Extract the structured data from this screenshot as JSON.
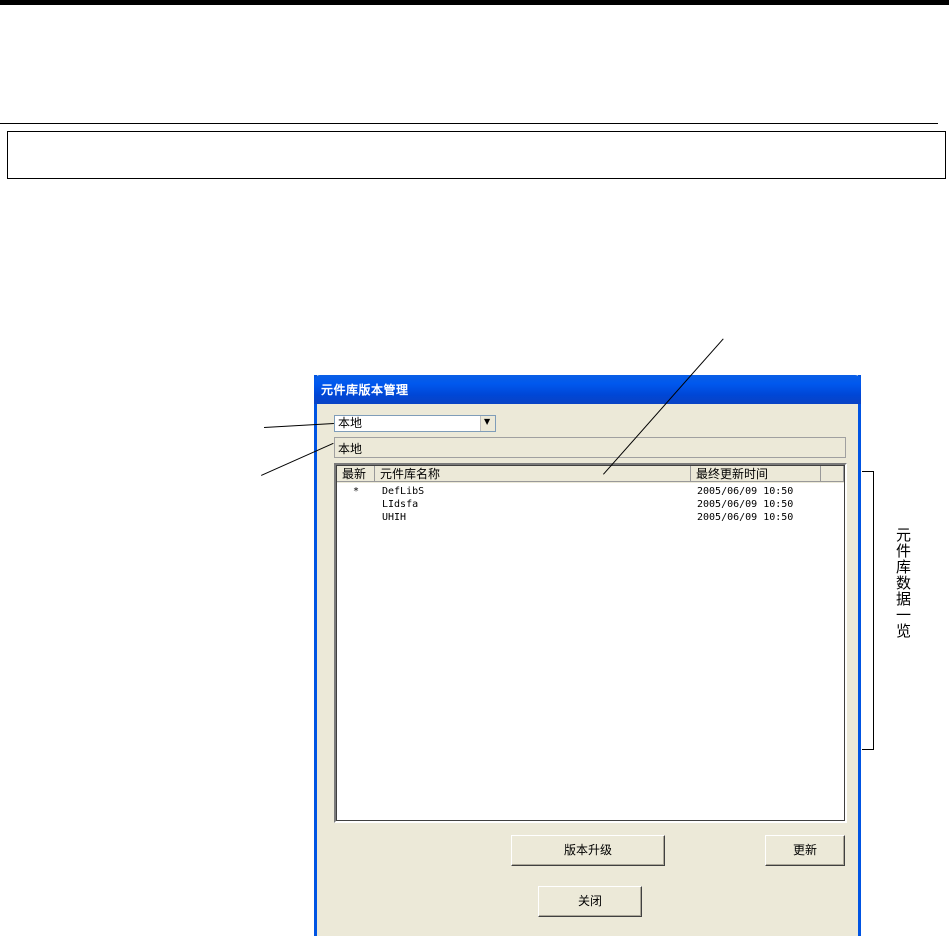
{
  "dialog": {
    "title": "元件库版本管理",
    "location_select": {
      "value": "本地"
    },
    "location_status": "本地",
    "list": {
      "columns": [
        "最新",
        "元件库名称",
        "最终更新时间"
      ],
      "rows": [
        {
          "latest": "*",
          "name": "DefLibS",
          "updated": "2005/06/09  10:50"
        },
        {
          "latest": "",
          "name": "LIdsfa",
          "updated": "2005/06/09  10:50"
        },
        {
          "latest": "",
          "name": "UHIH",
          "updated": "2005/06/09  10:50"
        }
      ]
    },
    "buttons": {
      "upgrade": "版本升级",
      "update": "更新",
      "close": "关闭"
    }
  },
  "annotations": {
    "list_caption": "元件库数据一览"
  }
}
